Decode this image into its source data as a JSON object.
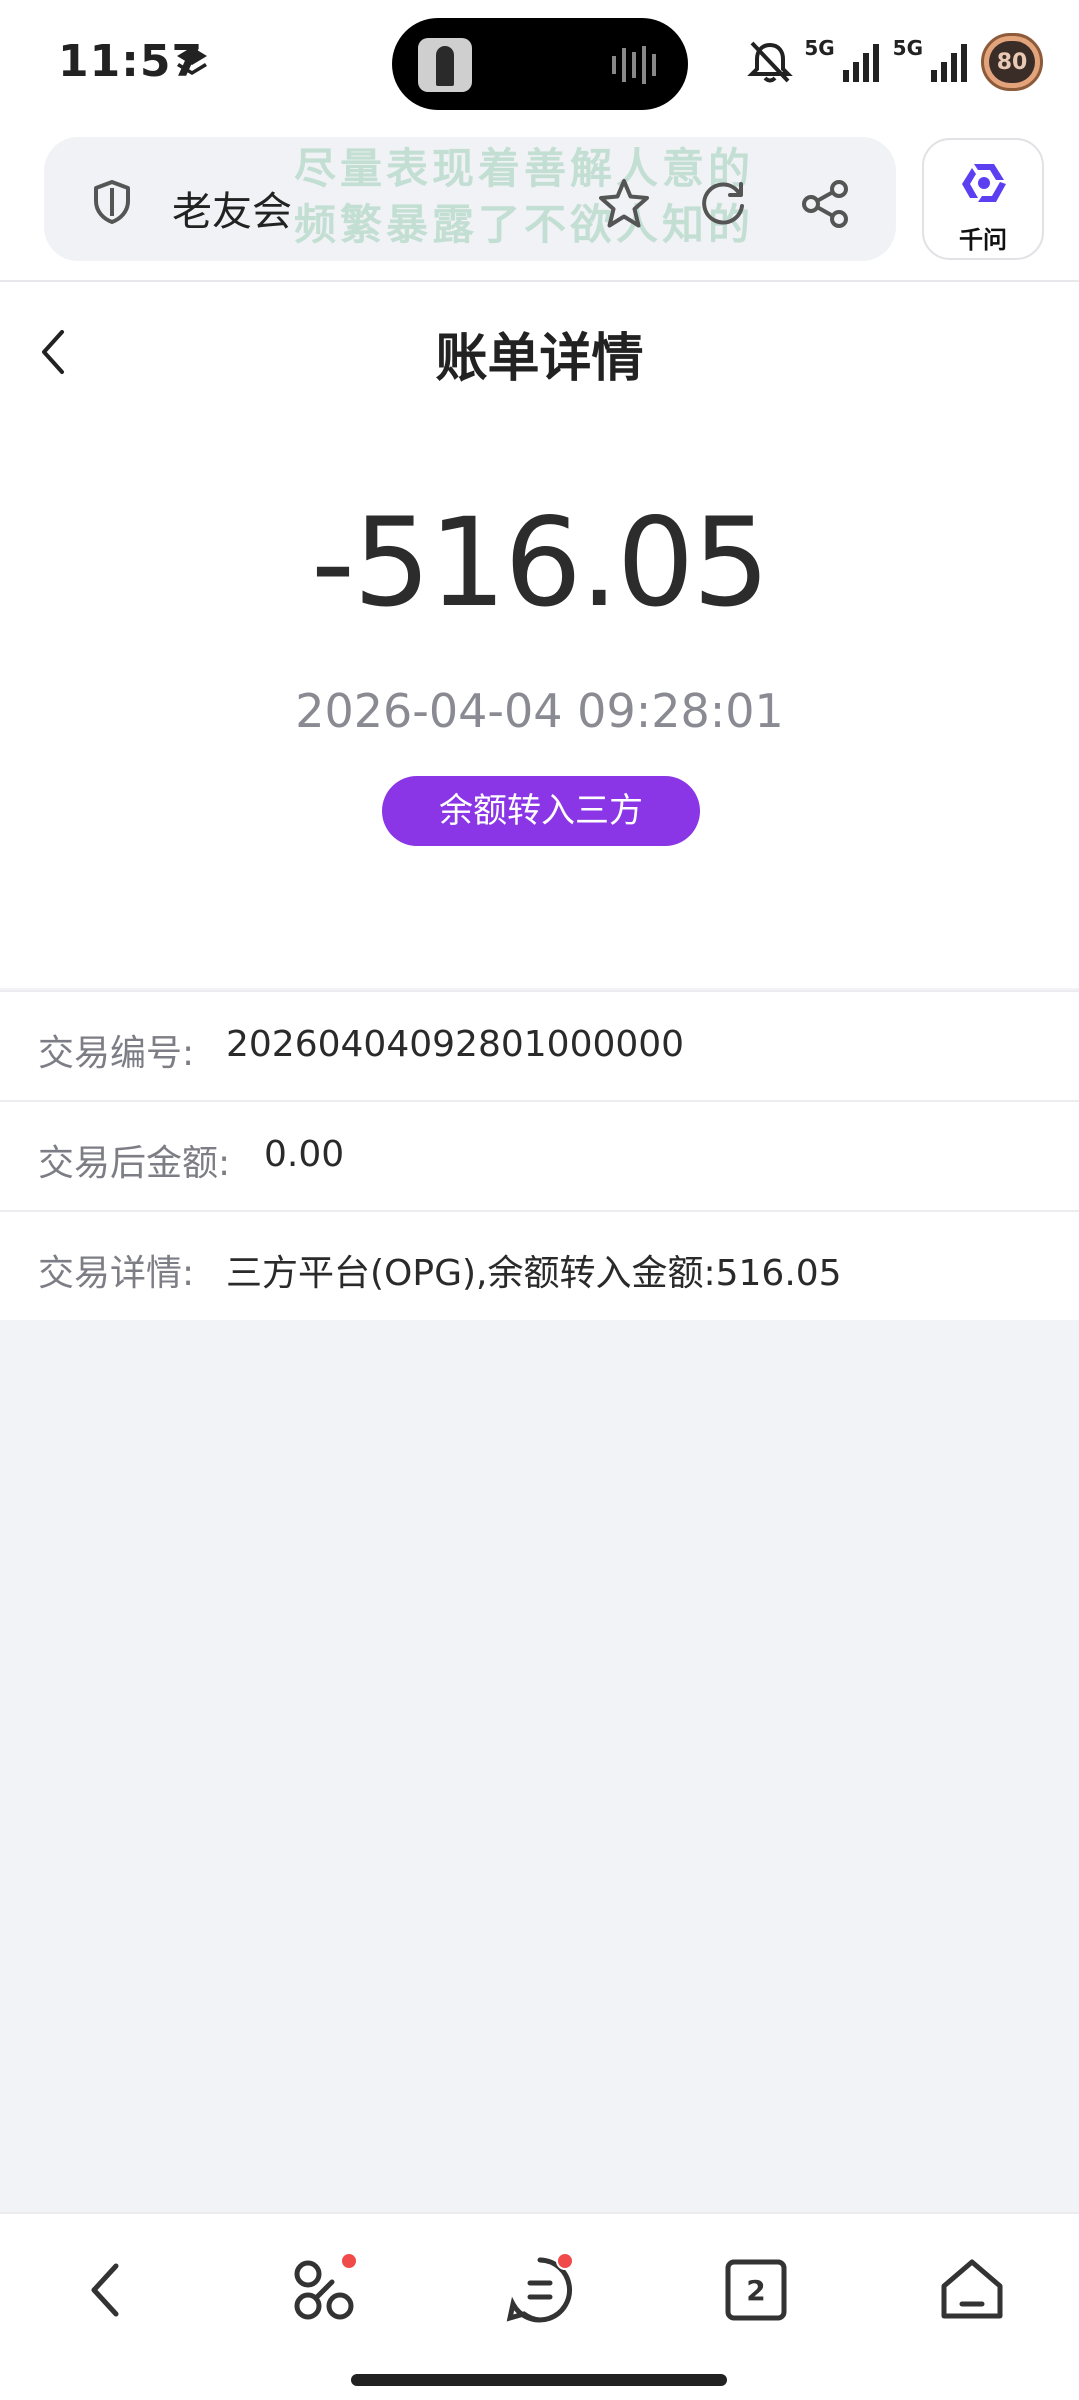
{
  "status_bar": {
    "time": "11:57",
    "signal_1": "5G",
    "signal_2": "5G",
    "battery": "80"
  },
  "browser": {
    "site_name": "老友会",
    "watermark_line1": "尽量表现着善解人意的",
    "watermark_line2": "频繁暴露了不欲人知的",
    "assistant_label": "千问"
  },
  "header": {
    "title": "账单详情"
  },
  "summary": {
    "amount": "-516.05",
    "datetime": "2026-04-04 09:28:01",
    "type_badge": "余额转入三方"
  },
  "details": [
    {
      "label": "交易编号:",
      "value": "20260404092801000000"
    },
    {
      "label": "交易后金额:",
      "value": "0.00"
    },
    {
      "label": "交易详情:",
      "value": "三方平台(OPG),余额转入金额:516.05"
    }
  ],
  "bottom_nav": {
    "tab_count": "2"
  },
  "colors": {
    "accent": "#8a35e6",
    "background": "#f2f3f7",
    "notification_dot": "#f04a4a"
  }
}
